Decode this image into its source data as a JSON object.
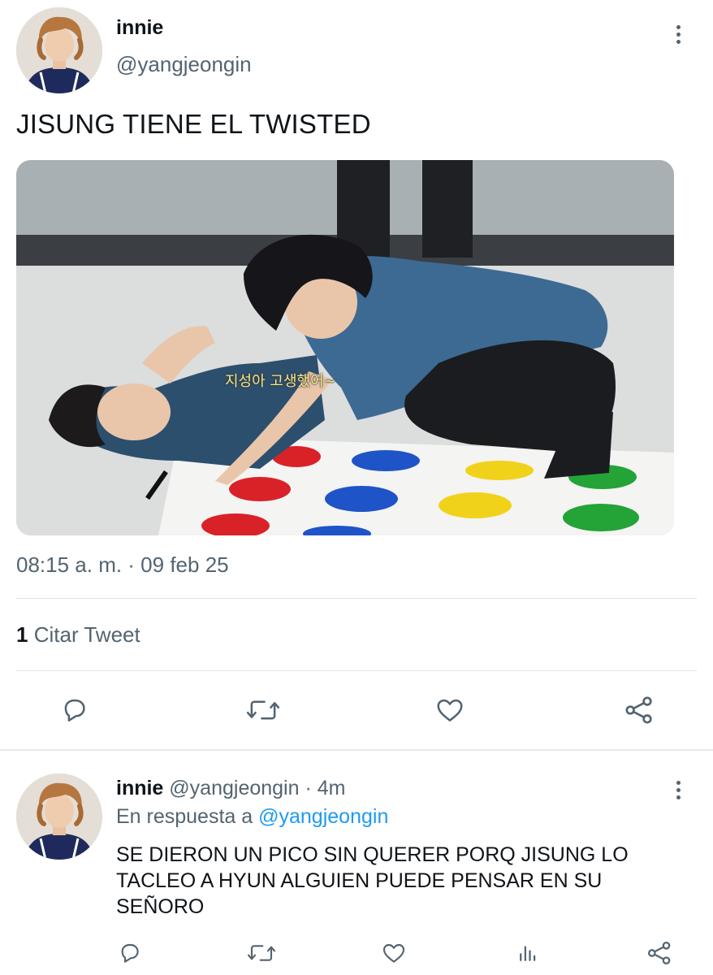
{
  "main_tweet": {
    "author_name": "innie",
    "author_handle": "@yangjeongin",
    "text": "JISUNG TIENE EL TWISTED",
    "media_caption": "지성아 고생했어~",
    "timestamp": "08:15 a. m. · 09 feb 25",
    "quote_count": "1",
    "quote_label": "Citar Tweet",
    "actions": [
      "reply-icon",
      "retweet-icon",
      "like-icon",
      "share-icon"
    ]
  },
  "reply": {
    "author_name": "innie",
    "author_handle": "@yangjeongin",
    "separator": " · ",
    "time": "4m",
    "replying_prefix": "En respuesta a ",
    "replying_handle": "@yangjeongin",
    "text": "SE DIERON UN PICO SIN QUERER PORQ JISUNG LO TACLEO A HYUN ALGUIEN PUEDE PENSAR EN SU SEÑORO",
    "actions": [
      "reply-icon",
      "retweet-icon",
      "like-icon",
      "analytics-icon",
      "share-icon"
    ]
  },
  "colors": {
    "text_primary": "#0f1419",
    "text_secondary": "#536471",
    "link": "#1d9bf0",
    "divider": "#dfe3e6"
  }
}
